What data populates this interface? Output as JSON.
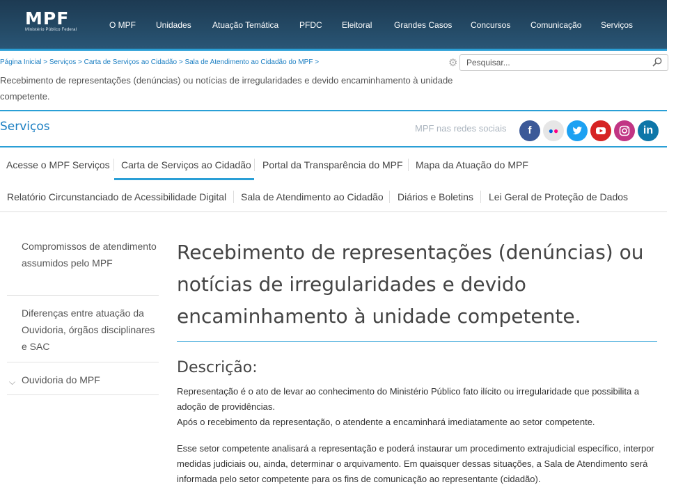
{
  "header": {
    "logo_main": "MPF",
    "logo_sub": "Ministério Público Federal",
    "nav": [
      "O MPF",
      "Unidades",
      "Atuação Temática",
      "PFDC",
      "Eleitoral",
      "Grandes Casos",
      "Concursos",
      "Comunicação",
      "Serviços"
    ]
  },
  "breadcrumb": [
    "Página Inicial >",
    "Serviços >",
    "Carta de Serviços ao Cidadão >",
    "Sala de Atendimento ao Cidadão do MPF >"
  ],
  "page_subtitle": "Recebimento de representações (denúncias) ou notícias de irregularidades e devido encaminhamento à unidade competente.",
  "search": {
    "placeholder": "Pesquisar..."
  },
  "section": {
    "title": "Serviços",
    "social_label": "MPF nas redes sociais"
  },
  "social": [
    {
      "name": "facebook",
      "glyph": "f",
      "color": "#3b5998"
    },
    {
      "name": "flickr",
      "glyph": "••",
      "color": "#e8e8e8"
    },
    {
      "name": "twitter",
      "glyph": "t",
      "color": "#1da1f2"
    },
    {
      "name": "youtube",
      "glyph": "▶",
      "color": "#d62424"
    },
    {
      "name": "instagram",
      "glyph": "◎",
      "color": "#c13584"
    },
    {
      "name": "linkedin",
      "glyph": "in",
      "color": "#0e76a8"
    }
  ],
  "tabs_row1": [
    "Acesse o MPF Serviços",
    "Carta de Serviços ao Cidadão",
    "Portal da Transparência do MPF",
    "Mapa da Atuação do MPF"
  ],
  "tabs_row2": [
    "Relatório Circunstanciado de Acessibilidade Digital",
    "Sala de Atendimento ao Cidadão",
    "Diários e Boletins",
    "Lei Geral de Proteção de Dados"
  ],
  "side_menu": [
    "Compromissos de atendimento assumidos pelo MPF",
    "Diferenças entre atuação da Ouvidoria, órgãos disciplinares e SAC",
    "Ouvidoria do MPF"
  ],
  "main": {
    "title": "Recebimento de representações (denúncias) ou notícias de irregularidades e devido encaminhamento à unidade competente.",
    "desc_heading": "Descrição:",
    "para1": "Representação é o ato de levar ao conhecimento do Ministério Público fato ilícito ou irregularidade que possibilita a adoção de providências.",
    "para2": "Após o recebimento da representação, o atendente a encaminhará imediatamente ao setor competente.",
    "para3": "Esse setor competente analisará a representação e poderá instaurar um procedimento extrajudicial específico, interpor medidas judiciais ou, ainda, determinar o arquivamento. Em quaisquer dessas situações, a Sala de Atendimento será informada pelo setor competente para os fins de comunicação ao representante (cidadão)."
  }
}
